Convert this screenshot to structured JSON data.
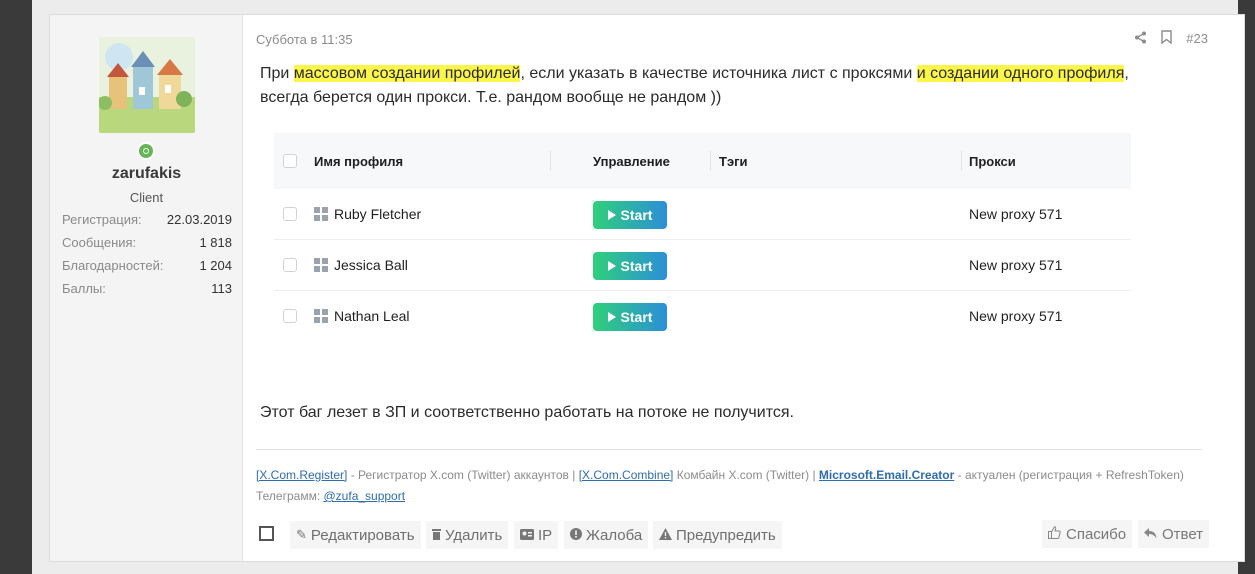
{
  "user": {
    "name": "zarufakis",
    "title": "Client",
    "stats": [
      {
        "label": "Регистрация:",
        "value": "22.03.2019"
      },
      {
        "label": "Сообщения:",
        "value": "1 818"
      },
      {
        "label": "Благодарностей:",
        "value": "1 204"
      },
      {
        "label": "Баллы:",
        "value": "113"
      }
    ]
  },
  "post": {
    "date": "Суббота в 11:35",
    "number": "#23",
    "message": {
      "p1": "При ",
      "h1": "массовом создании профилей",
      "p2": ", если указать в качестве источника лист с проксями ",
      "h2": "и создании одного профиля",
      "p3": ",",
      "line2": "всегда берется один прокси. Т.е. рандом вообще не рандом ))"
    },
    "message2": "Этот баг лезет в ЗП и соответственно работать на потоке не получится."
  },
  "screenshot": {
    "headers": {
      "name": "Имя профиля",
      "control": "Управление",
      "tags": "Тэги",
      "proxy": "Прокси"
    },
    "rows": [
      {
        "name": "Ruby Fletcher",
        "button": "Start",
        "proxy": "New proxy 571"
      },
      {
        "name": "Jessica Ball",
        "button": "Start",
        "proxy": "New proxy 571"
      },
      {
        "name": "Nathan Leal",
        "button": "Start",
        "proxy": "New proxy 571"
      }
    ]
  },
  "signature": {
    "link1": "[X.Com.Register]",
    "text1": " - Регистратор X.com (Twitter) аккаунтов | ",
    "link2": "[X.Com.Combine]",
    "text2": " Комбайн X.com (Twitter) | ",
    "link3": "Microsoft.Email.Creator",
    "text3": " - актуален (регистрация + RefreshToken)",
    "telegram_label": "Телеграмм: ",
    "telegram": "@zufa_support"
  },
  "actions": {
    "edit": "Редактировать",
    "delete": "Удалить",
    "ip": "IP",
    "report": "Жалоба",
    "warn": "Предупредить",
    "like": "Спасибо",
    "reply": "Ответ"
  },
  "colors": {
    "highlight": "#fcf64a",
    "online": "#63b655",
    "start_from": "#2fd07a",
    "start_to": "#2c8fd8"
  }
}
